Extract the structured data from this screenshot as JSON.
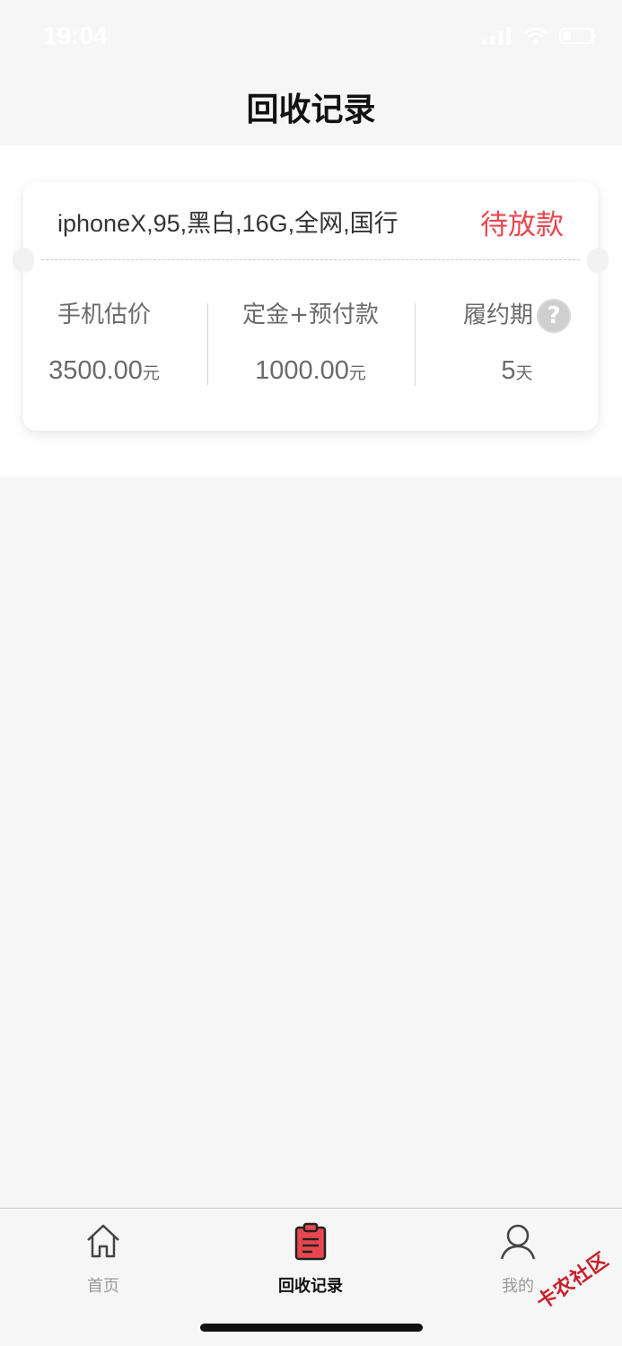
{
  "status_bar": {
    "time": "19:04"
  },
  "nav": {
    "title": "回收记录"
  },
  "record": {
    "description": "iphoneX,95,黑白,16G,全网,国行",
    "status": "待放款",
    "stats": [
      {
        "label": "手机估价",
        "value": "3500.00",
        "unit": "元"
      },
      {
        "label": "定金+预付款",
        "value": "1000.00",
        "unit": "元"
      },
      {
        "label": "履约期",
        "value": "5",
        "unit": "天"
      }
    ],
    "help_icon": "?"
  },
  "tabbar": {
    "items": [
      {
        "label": "首页",
        "icon": "home-icon",
        "active": false
      },
      {
        "label": "回收记录",
        "icon": "clipboard-icon",
        "active": true
      },
      {
        "label": "我的",
        "icon": "user-icon",
        "active": false
      }
    ]
  },
  "watermark": "卡农社区",
  "colors": {
    "accent": "#e8474f",
    "background": "#f6f6f6",
    "card": "#ffffff"
  }
}
